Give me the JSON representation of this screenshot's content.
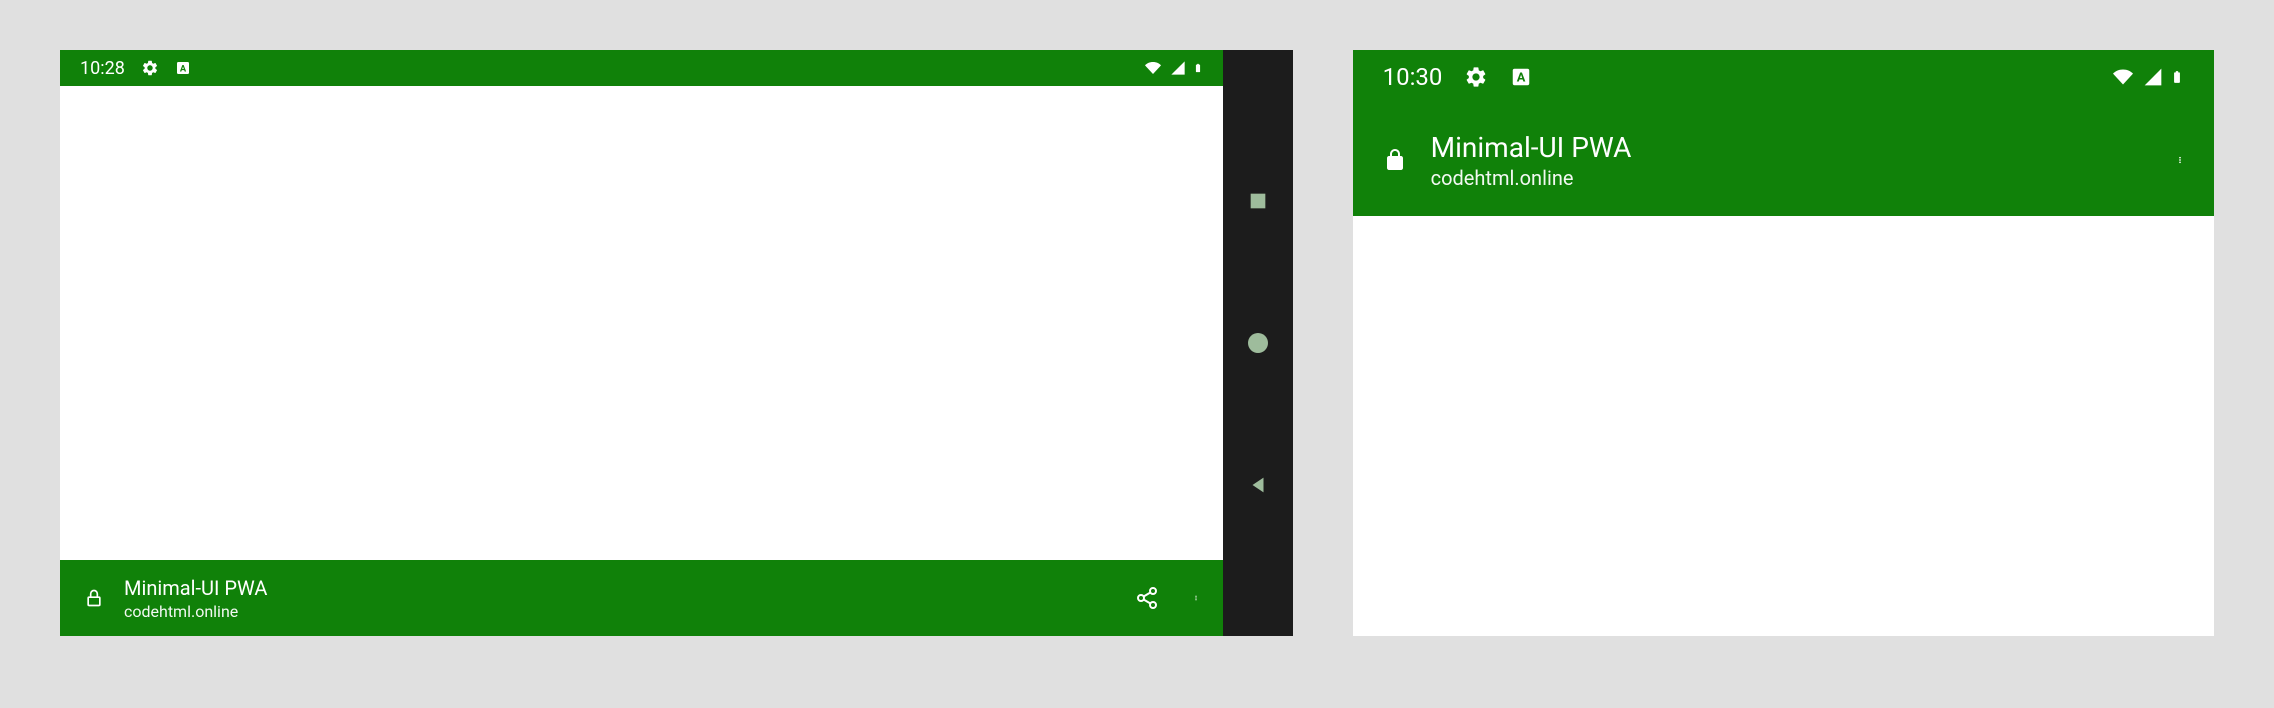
{
  "devices": {
    "landscape": {
      "statusTime": "10:28",
      "appTitle": "Minimal-UI PWA",
      "appDomain": "codehtml.online"
    },
    "portrait": {
      "statusTime": "10:30",
      "appTitle": "Minimal-UI PWA",
      "appDomain": "codehtml.online"
    }
  },
  "colors": {
    "primary": "#108109",
    "navBg": "#1c1c1c",
    "navIcon": "#9ebc9c"
  }
}
